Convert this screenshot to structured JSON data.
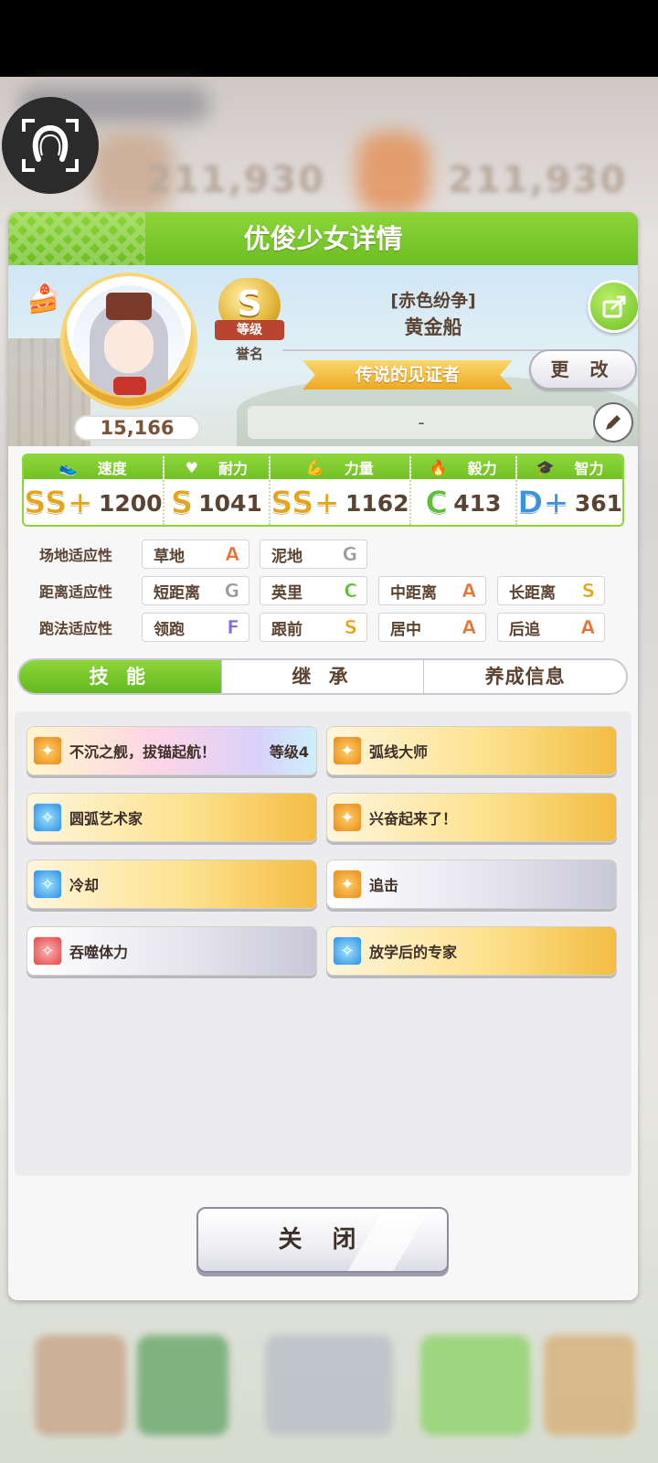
{
  "dialog": {
    "title": "优俊少女详情"
  },
  "profile": {
    "fans": "15,166",
    "rank": {
      "grade": "S",
      "ribbon": "等级",
      "label": "誉名"
    },
    "epithet": "[赤色纷争]",
    "name": "黄金船",
    "title_banner": "传说的见证者",
    "change_label": "更 改",
    "comment": "-"
  },
  "stats": [
    {
      "label": "速度",
      "icon": "shoe-icon",
      "grade": "SS+",
      "value": "1200",
      "color": "gold"
    },
    {
      "label": "耐力",
      "icon": "heart-icon",
      "grade": "S",
      "value": "1041",
      "color": "gold"
    },
    {
      "label": "力量",
      "icon": "muscle-icon",
      "grade": "SS+",
      "value": "1162",
      "color": "gold"
    },
    {
      "label": "毅力",
      "icon": "flame-icon",
      "grade": "C",
      "value": "413",
      "color": "green"
    },
    {
      "label": "智力",
      "icon": "mortarboard-icon",
      "grade": "D+",
      "value": "361",
      "color": "blue"
    }
  ],
  "aptitude": {
    "surface": {
      "label": "场地适应性",
      "items": [
        {
          "name": "草地",
          "grade": "A"
        },
        {
          "name": "泥地",
          "grade": "G"
        }
      ]
    },
    "distance": {
      "label": "距离适应性",
      "items": [
        {
          "name": "短距离",
          "grade": "G"
        },
        {
          "name": "英里",
          "grade": "C"
        },
        {
          "name": "中距离",
          "grade": "A"
        },
        {
          "name": "长距离",
          "grade": "S"
        }
      ]
    },
    "strategy": {
      "label": "跑法适应性",
      "items": [
        {
          "name": "领跑",
          "grade": "F"
        },
        {
          "name": "跟前",
          "grade": "S"
        },
        {
          "name": "居中",
          "grade": "A"
        },
        {
          "name": "后追",
          "grade": "A"
        }
      ]
    }
  },
  "tabs": [
    {
      "label": "技 能",
      "active": true
    },
    {
      "label": "继 承",
      "active": false
    },
    {
      "label": "养成信息",
      "active": false
    }
  ],
  "skills": [
    {
      "name": "不沉之舰，拔锚起航！",
      "level": "等级4",
      "style": "rainbow",
      "icon": "orange"
    },
    {
      "name": "弧线大师",
      "style": "gold",
      "icon": "orange"
    },
    {
      "name": "圆弧艺术家",
      "style": "gold",
      "icon": "blue"
    },
    {
      "name": "兴奋起来了！",
      "style": "gold",
      "icon": "orange"
    },
    {
      "name": "冷却",
      "style": "gold",
      "icon": "blue"
    },
    {
      "name": "追击",
      "style": "silver",
      "icon": "orange"
    },
    {
      "name": "吞噬体力",
      "style": "silver",
      "icon": "red"
    },
    {
      "name": "放学后的专家",
      "style": "gold",
      "icon": "blue"
    }
  ],
  "close_label": "关 闭",
  "background": {
    "left_value": "211,930",
    "right_value": "211,930"
  },
  "colors": {
    "accent_green": "#7ac52b",
    "text_brown": "#5b4332"
  }
}
